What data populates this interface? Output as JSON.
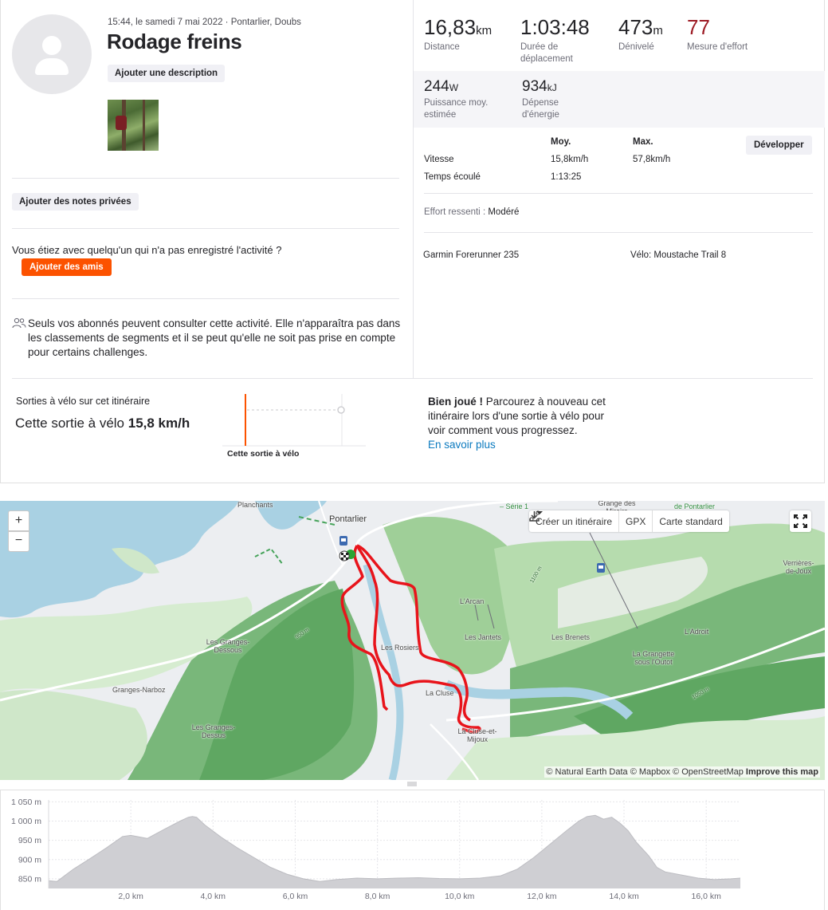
{
  "activity": {
    "meta_line": "15:44, le samedi 7 mai 2022 · Pontarlier, Doubs",
    "title": "Rodage freins",
    "add_description_label": "Ajouter une description",
    "add_private_notes_label": "Ajouter des notes privées",
    "friends_question": "Vous étiez avec quelqu'un qui n'a pas enregistré l'activité ?",
    "add_friends_label": "Ajouter des amis",
    "privacy_text": "Seuls vos abonnés peuvent consulter cette activité. Elle n'apparaîtra pas dans les classements de segments et il se peut qu'elle ne soit pas prise en compte pour certains challenges."
  },
  "stats": {
    "distance": {
      "value": "16,83",
      "unit": "km",
      "label": "Distance"
    },
    "moving_time": {
      "value": "1:03:48",
      "label": "Durée de déplacement"
    },
    "elevation": {
      "value": "473",
      "unit": "m",
      "label": "Dénivelé"
    },
    "effort": {
      "value": "77",
      "label": "Mesure d'effort",
      "color": "#9d1c25"
    },
    "power": {
      "value": "244",
      "unit": "W",
      "label": "Puissance moy. estimée"
    },
    "energy": {
      "value": "934",
      "unit": "kJ",
      "label": "Dépense d'énergie"
    }
  },
  "details": {
    "col_avg": "Moy.",
    "col_max": "Max.",
    "expand_label": "Développer",
    "rows": [
      {
        "label": "Vitesse",
        "avg": "15,8km/h",
        "max": "57,8km/h"
      },
      {
        "label": "Temps écoulé",
        "avg": "1:13:25",
        "max": ""
      }
    ],
    "perceived_effort_label": "Effort ressenti",
    "perceived_effort_value": "Modéré",
    "device": "Garmin Forerunner 235",
    "bike": "Vélo: Moustache Trail 8"
  },
  "route_section": {
    "title": "Sorties à vélo sur cet itinéraire",
    "speed_prefix": "Cette sortie à vélo",
    "speed_value": "15,8 km/h",
    "mini_chart_label": "Cette sortie à vélo",
    "encourage_bold": "Bien joué !",
    "encourage_text": " Parcourez à nouveau cet itinéraire lors d'une sortie à vélo pour voir comment vous progressez.",
    "learn_more": "En savoir plus"
  },
  "map": {
    "zoom_in": "+",
    "zoom_out": "−",
    "create_route": "Créer un itinéraire",
    "gpx": "GPX",
    "map_style": "Carte standard",
    "attribution_plain": "© Natural Earth Data © Mapbox © OpenStreetMap ",
    "attribution_bold": "Improve this map",
    "route_color": "#e8141b",
    "labels": {
      "planchants": "Planchants",
      "pontarlier": "Pontarlier",
      "serie1": "– Série 1",
      "grange_des_miroirs": "Grange des Miroirs",
      "de_pontarlier": "de Pontarlier",
      "verrieres": "Verrières-de-Joux",
      "larcan": "L'Arcan",
      "les_jantets": "Les Jantets",
      "les_brenets": "Les Brenets",
      "ladroit": "L'Adroit",
      "la_grangette": "La Grangette sous l'Outot",
      "les_rosiers": "Les Rosiers",
      "la_cluse": "La Cluse",
      "la_cluse_mijoux": "La Cluse-et-Mijoux",
      "granges_dessous": "Les Granges-Dessous",
      "granges_narboz": "Granges-Narboz",
      "granges_dessus": "Les Granges-Dessus",
      "c950": "950 m",
      "c1100": "1100 m",
      "c1050": "1050 m"
    }
  },
  "chart_data": {
    "type": "area",
    "title": "",
    "xlabel": "",
    "ylabel": "",
    "x_ticks": [
      "2,0 km",
      "4,0 km",
      "6,0 km",
      "8,0 km",
      "10,0 km",
      "12,0 km",
      "14,0 km",
      "16,0 km"
    ],
    "y_ticks": [
      "850 m",
      "900 m",
      "950 m",
      "1 000 m",
      "1 050 m"
    ],
    "xlim": [
      0,
      16.83
    ],
    "ylim": [
      825,
      1055
    ],
    "x": [
      0,
      0.2,
      0.6,
      1.0,
      1.4,
      1.8,
      2.0,
      2.4,
      2.8,
      3.2,
      3.4,
      3.5,
      3.6,
      3.8,
      4.2,
      4.6,
      5.0,
      5.4,
      5.8,
      6.2,
      6.6,
      7.0,
      7.5,
      8.0,
      8.5,
      9.0,
      9.5,
      10.0,
      10.5,
      11.0,
      11.4,
      11.8,
      12.2,
      12.6,
      12.9,
      13.1,
      13.3,
      13.5,
      13.7,
      13.9,
      14.1,
      14.3,
      14.6,
      14.8,
      15.0,
      15.4,
      15.8,
      16.2,
      16.6,
      16.83
    ],
    "series": [
      {
        "values": [
          845,
          843,
          875,
          902,
          930,
          960,
          963,
          955,
          978,
          1000,
          1010,
          1012,
          1010,
          990,
          958,
          930,
          905,
          880,
          862,
          850,
          843,
          848,
          852,
          850,
          852,
          853,
          851,
          850,
          852,
          858,
          875,
          905,
          940,
          975,
          1000,
          1012,
          1015,
          1005,
          1010,
          995,
          975,
          945,
          910,
          880,
          868,
          860,
          852,
          848,
          850,
          852
        ]
      }
    ]
  },
  "mini_chart_data": {
    "type": "scatter",
    "series": [
      {
        "values": [
          15.8
        ]
      }
    ]
  }
}
